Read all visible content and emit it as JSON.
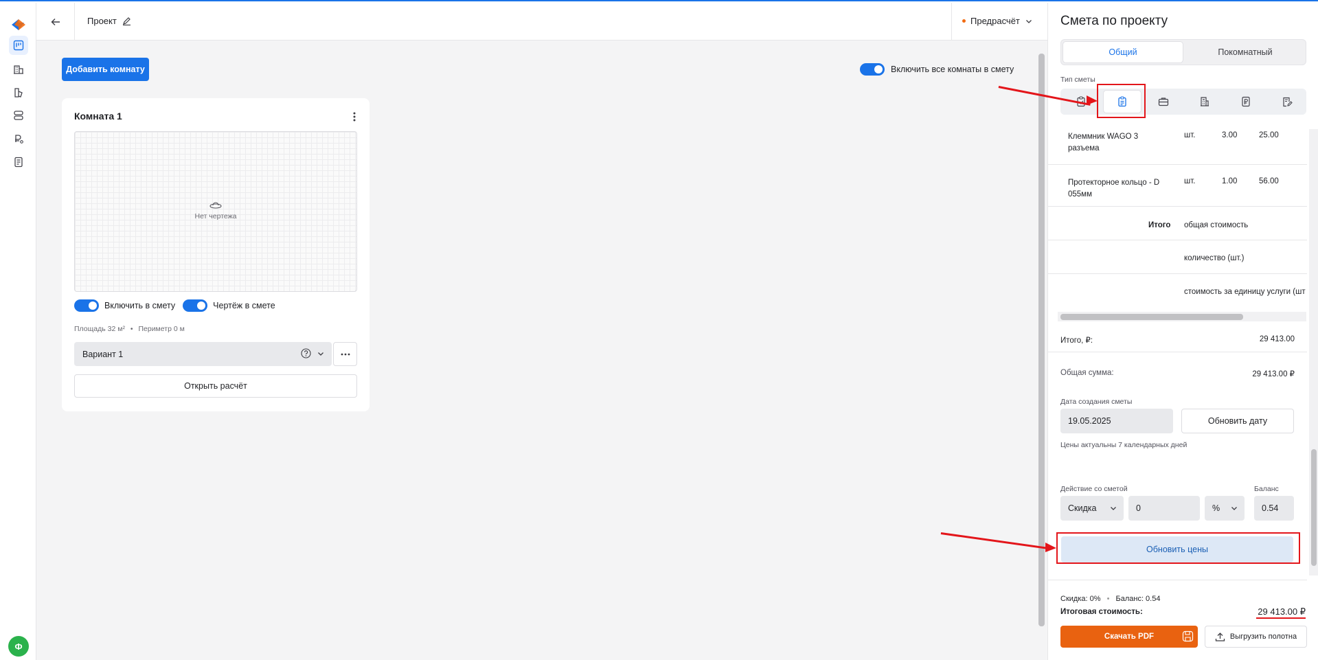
{
  "header": {
    "title": "Проект",
    "status": "Предрасчёт"
  },
  "main": {
    "add_room_label": "Добавить комнату",
    "include_all_label": "Включить все комнаты в смету",
    "room": {
      "title": "Комната 1",
      "no_drawing": "Нет чертежа",
      "include_label": "Включить в смету",
      "drawing_label": "Чертёж в смете",
      "area": "Площадь 32 м²",
      "perimeter": "Периметр 0 м",
      "variant": "Вариант 1",
      "open_calc_label": "Открыть расчёт"
    }
  },
  "user": {
    "avatar_letter": "Ф"
  },
  "panel": {
    "title": "Смета по проекту",
    "tabs": [
      {
        "label": "Общий",
        "active": true
      },
      {
        "label": "Покомнатный",
        "active": false
      }
    ],
    "type_label": "Тип сметы",
    "type_icons": [
      "clipboard-check-icon",
      "clipboard-list-icon",
      "briefcase-icon",
      "calculator-icon",
      "ruble-document-icon",
      "edit-document-icon"
    ],
    "table": {
      "rows": [
        {
          "name": "Клеммник WAGO 3 разъема",
          "unit": "шт.",
          "qty": "3.00",
          "price": "25.00"
        },
        {
          "name": "Протекторное кольцо - D 055мм",
          "unit": "шт.",
          "qty": "1.00",
          "price": "56.00"
        }
      ],
      "total_label": "Итого",
      "total_lines": [
        "общая стоимость",
        "количество (шт.)",
        "стоимость за единицу услуги (шт"
      ]
    },
    "itogo_label": "Итого, ₽:",
    "itogo_value": "29 413.00",
    "sum_label": "Общая сумма:",
    "sum_value": "29 413.00 ₽",
    "date_label": "Дата создания сметы",
    "date_value": "19.05.2025",
    "update_date_label": "Обновить дату",
    "prices_note": "Цены актуальны 7 календарных дней",
    "action_label": "Действие со сметой",
    "balance_label": "Баланс",
    "action_value": "Скидка",
    "action_amount": "0",
    "action_unit": "%",
    "balance_value": "0.54",
    "update_prices_label": "Обновить цены",
    "discount_text": "Скидка: 0%",
    "balance_text": "Баланс: 0.54",
    "final_label": "Итоговая стоимость:",
    "final_value": "29 413.00 ₽",
    "pdf_label": "Скачать PDF",
    "export_label": "Выгрузить полотна"
  },
  "colors": {
    "accent": "#1a73e8",
    "orange": "#e96210",
    "annotation": "#e3151a"
  }
}
